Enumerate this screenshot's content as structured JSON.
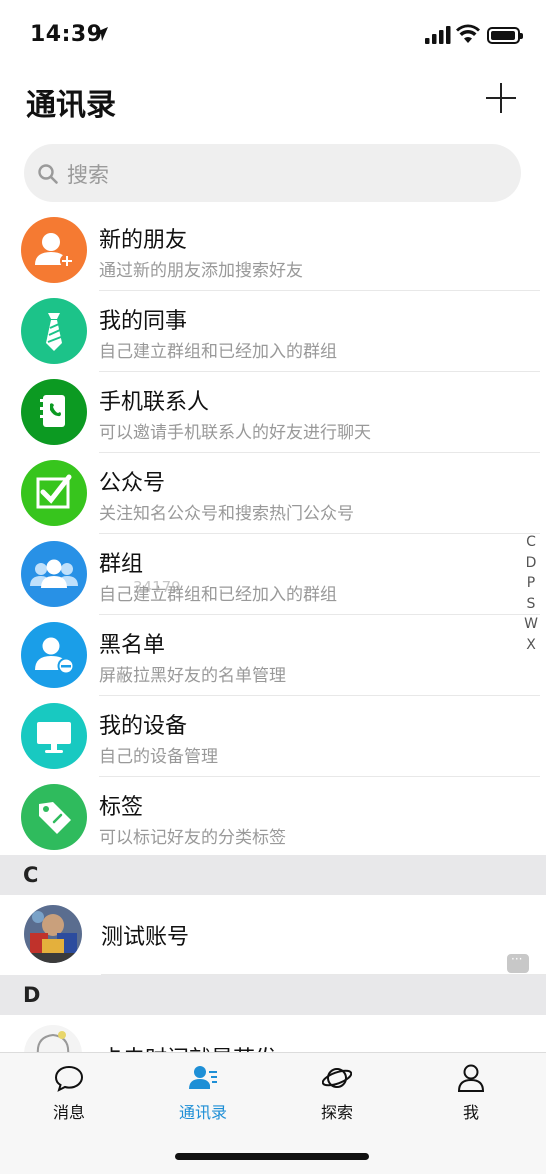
{
  "status_bar": {
    "time": "14:39"
  },
  "header": {
    "title": "通讯录"
  },
  "search": {
    "placeholder": "搜索"
  },
  "entries": [
    {
      "title": "新的朋友",
      "subtitle": "通过新的朋友添加搜索好友",
      "icon": "add-person-icon",
      "color": "#f57a32"
    },
    {
      "title": "我的同事",
      "subtitle": "自己建立群组和已经加入的群组",
      "icon": "tie-icon",
      "color": "#1cc389"
    },
    {
      "title": "手机联系人",
      "subtitle": "可以邀请手机联系人的好友进行聊天",
      "icon": "phonebook-icon",
      "color": "#0c9a22"
    },
    {
      "title": "公众号",
      "subtitle": "关注知名公众号和搜索热门公众号",
      "icon": "checkbox-icon",
      "color": "#37c51d"
    },
    {
      "title": "群组",
      "subtitle": "自己建立群组和已经加入的群组",
      "icon": "group-icon",
      "color": "#2891e6"
    },
    {
      "title": "黑名单",
      "subtitle": "屏蔽拉黑好友的名单管理",
      "icon": "block-person-icon",
      "color": "#1a9ee8"
    },
    {
      "title": "我的设备",
      "subtitle": "自己的设备管理",
      "icon": "monitor-icon",
      "color": "#18c9c1"
    },
    {
      "title": "标签",
      "subtitle": "可以标记好友的分类标签",
      "icon": "tag-icon",
      "color": "#2fbb5d"
    }
  ],
  "index_letters": [
    "C",
    "D",
    "P",
    "S",
    "W",
    "X"
  ],
  "watermark": "34179",
  "sections": [
    {
      "letter": "C",
      "contacts": [
        {
          "name": "测试账号"
        }
      ]
    },
    {
      "letter": "D",
      "contacts": [
        {
          "name": "卡夫时间就是若发"
        }
      ]
    }
  ],
  "tabbar": {
    "tabs": [
      {
        "label": "消息",
        "icon": "chat-bubble-icon"
      },
      {
        "label": "通讯录",
        "icon": "contacts-icon",
        "active": true
      },
      {
        "label": "探索",
        "icon": "planet-icon"
      },
      {
        "label": "我",
        "icon": "person-icon"
      }
    ]
  },
  "colors": {
    "accent": "#1e8fd6",
    "section_bg": "#e8e8ea"
  }
}
